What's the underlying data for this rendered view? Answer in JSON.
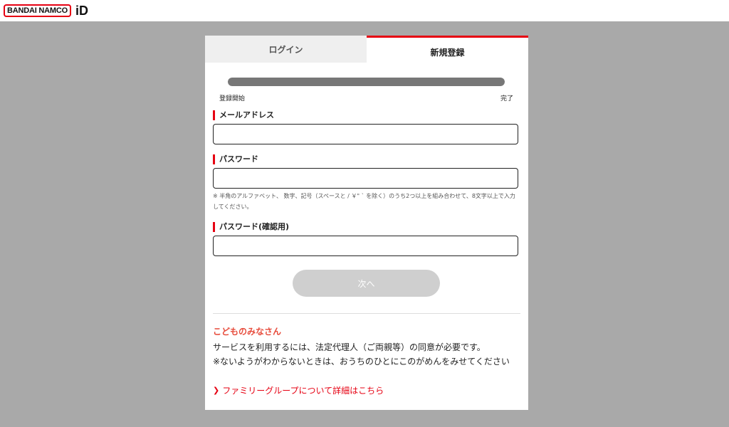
{
  "brand": {
    "logo_text": "BANDAI NAMCO",
    "id_text": "iD",
    "accent_color": "#e60012"
  },
  "tabs": [
    {
      "label": "ログイン",
      "active": false
    },
    {
      "label": "新規登録",
      "active": true
    }
  ],
  "progress": {
    "start_label": "登録開始",
    "end_label": "完了",
    "percent": 100
  },
  "form": {
    "email": {
      "label": "メールアドレス",
      "value": ""
    },
    "password": {
      "label": "パスワード",
      "value": "",
      "hint": "※ 半角のアルファベット、 数字、記号（スペースと / ￥\" ` を除く）のうち2つ以上を組み合わせて、8文字以上で入力してください。"
    },
    "password_confirm": {
      "label": "パスワード(確認用)",
      "value": ""
    }
  },
  "next_button": {
    "label": "次へ",
    "enabled": false
  },
  "kids": {
    "title": "こどものみなさん",
    "line1": "サービスを利用するには、法定代理人（ご両親等）の同意が必要です。",
    "line2": "※ないようがわからないときは、おうちのひとにこのがめんをみせてください",
    "link_label": "ファミリーグループについて詳細はこちら",
    "link_icon": "chevron-right-icon"
  }
}
